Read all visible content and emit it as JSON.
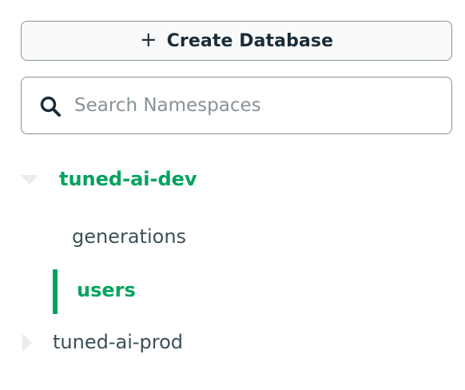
{
  "toolbar": {
    "create_icon": "plus-icon",
    "create_label": "Create Database"
  },
  "search": {
    "icon": "search-icon",
    "placeholder": "Search Namespaces",
    "value": ""
  },
  "tree": {
    "databases": [
      {
        "name": "tuned-ai-dev",
        "expanded": true,
        "collections": [
          {
            "name": "generations",
            "selected": false
          },
          {
            "name": "users",
            "selected": true
          }
        ]
      },
      {
        "name": "tuned-ai-prod",
        "expanded": false,
        "collections": []
      }
    ]
  },
  "colors": {
    "accent": "#00a35c",
    "text": "#3d4f58",
    "dark_text": "#1c2d38",
    "border": "#889397",
    "placeholder": "#889397",
    "caret": "#e8edeb"
  }
}
